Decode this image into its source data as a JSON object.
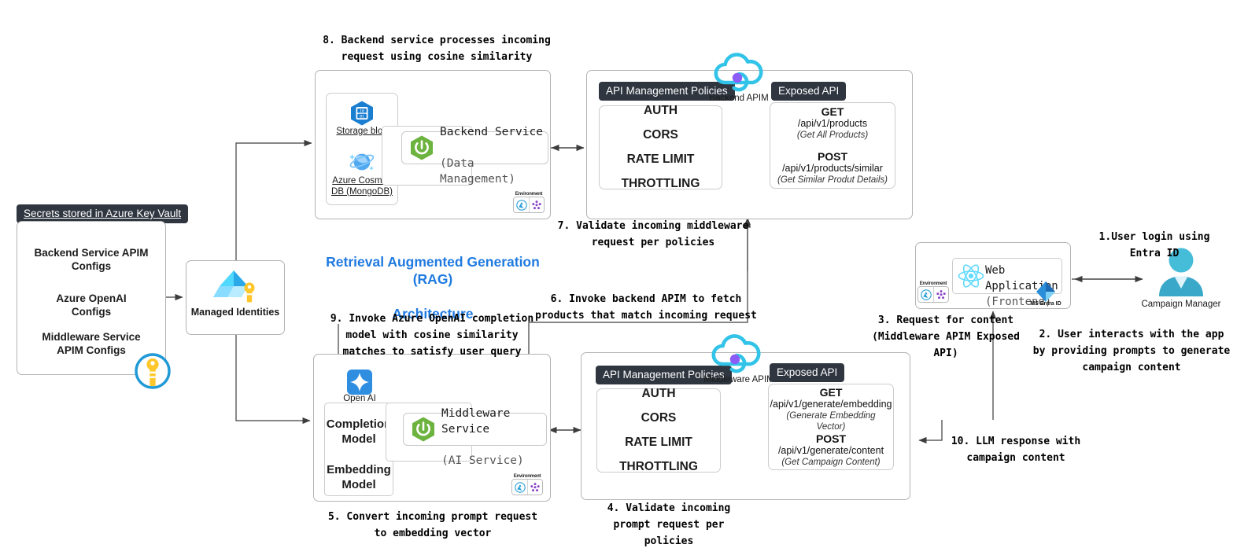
{
  "title": {
    "line1": "Retrieval Augmented Generation (RAG)",
    "line2": "Architecture"
  },
  "key_vault": {
    "header": "Secrets stored in Azure Key Vault",
    "configs": [
      "Backend Service APIM\nConfigs",
      "Azure OpenAI\nConfigs",
      "Middleware Service\nAPIM Configs"
    ],
    "key_icon": "key-icon"
  },
  "managed_identities": {
    "label": "Managed Identities",
    "icon": "managed-identities-icon"
  },
  "backend_group": {
    "storage_blob": {
      "label": "Storage blob",
      "icon": "azure-storage-blob-icon"
    },
    "cosmos_db": {
      "label": "Azure Cosmos\nDB (MongoDB)",
      "icon": "azure-cosmos-db-icon"
    },
    "service": {
      "name": "Backend Service",
      "sub": "(Data Management)",
      "icon": "spring-boot-icon"
    },
    "environment": {
      "label": "Environment",
      "icons": [
        "azure-icon",
        "resource-group-icon"
      ]
    }
  },
  "backend_apim": {
    "name": "Backend APIM",
    "icon": "apim-cloud-icon",
    "policies_label": "API Management Policies",
    "policies": [
      "AUTH",
      "CORS",
      "RATE LIMIT",
      "THROTTLING"
    ],
    "exposed_label": "Exposed API",
    "endpoints": [
      {
        "verb": "GET",
        "path": "/api/v1/products",
        "desc": "(Get All Products)"
      },
      {
        "verb": "POST",
        "path": "/api/v1/products/similar",
        "desc": "(Get Similar Produt Details)"
      }
    ]
  },
  "middleware_group": {
    "open_ai": {
      "label": "Open AI",
      "icon": "openai-icon"
    },
    "models": [
      "Completion\nModel",
      "Embedding\nModel"
    ],
    "service": {
      "name": "Middleware Service",
      "sub": "(AI Service)",
      "icon": "spring-boot-icon"
    },
    "environment": {
      "label": "Environment",
      "icons": [
        "azure-icon",
        "resource-group-icon"
      ]
    }
  },
  "middleware_apim": {
    "name": "Middleware APIM",
    "icon": "apim-cloud-icon",
    "policies_label": "API Management Policies",
    "policies": [
      "AUTH",
      "CORS",
      "RATE LIMIT",
      "THROTTLING"
    ],
    "exposed_label": "Exposed API",
    "endpoints": [
      {
        "verb": "GET",
        "path": "/api/v1/generate/embedding",
        "desc": "(Generate Embedding\nVector)"
      },
      {
        "verb": "POST",
        "path": "/api/v1/generate/content",
        "desc": "(Get Campaign Content)"
      }
    ]
  },
  "web_app": {
    "name": "Web Application",
    "sub": "(Frontend)",
    "icon": "react-icon",
    "entra_label": "MS Entra ID",
    "entra_icon": "ms-entra-id-icon",
    "environment": {
      "label": "Environment",
      "icons": [
        "azure-icon",
        "resource-group-icon"
      ]
    }
  },
  "user": {
    "label": "Campaign Manager",
    "icon": "user-avatar-icon"
  },
  "steps": {
    "s1": "1.User login using\nEntra ID",
    "s2": "2. User interacts with the app\nby providing prompts to generate\ncampaign content",
    "s3": "3. Request for content\n(Middleware APIM Exposed\nAPI)",
    "s4": "4. Validate incoming\nprompt request per\npolicies",
    "s5": "5. Convert incoming prompt request\nto embedding vector",
    "s6": "6. Invoke backend APIM to fetch\nproducts that match incoming request",
    "s7": "7. Validate incoming middleware\nrequest per policies",
    "s8": "8. Backend service processes incoming\nrequest using cosine similarity",
    "s9": "9. Invoke Azure OpenAI completion\nmodel with cosine similarity\nmatches to satisfy user query",
    "s10": "10. LLM response with\ncampaign content"
  },
  "colors": {
    "accent_blue": "#1f7ae0",
    "pill_dark": "#2f3640",
    "apim_cyan": "#32c3e8",
    "apim_purple": "#8b5cf6",
    "spring_green": "#6db33f",
    "key_yellow": "#ffc72c",
    "user_cyan": "#45bcd8",
    "react_cyan": "#61dafb"
  }
}
